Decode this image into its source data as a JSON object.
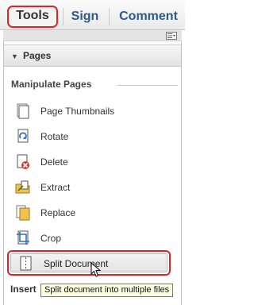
{
  "tabs": {
    "tools": "Tools",
    "sign": "Sign",
    "comment": "Comment"
  },
  "panel": {
    "header": "Pages",
    "section_title": "Manipulate Pages",
    "items": [
      {
        "label": "Page Thumbnails",
        "icon": "page-thumbnails-icon"
      },
      {
        "label": "Rotate",
        "icon": "rotate-icon"
      },
      {
        "label": "Delete",
        "icon": "delete-page-icon"
      },
      {
        "label": "Extract",
        "icon": "extract-icon"
      },
      {
        "label": "Replace",
        "icon": "replace-icon"
      },
      {
        "label": "Crop",
        "icon": "crop-icon"
      },
      {
        "label": "Split Document",
        "icon": "split-document-icon"
      }
    ],
    "next_section_label": "Insert"
  },
  "tooltip": "Split document into multiple files",
  "colors": {
    "highlight_border": "#d7262b",
    "tab_text": "#2d5a8a",
    "tooltip_bg": "#ffffe1"
  }
}
